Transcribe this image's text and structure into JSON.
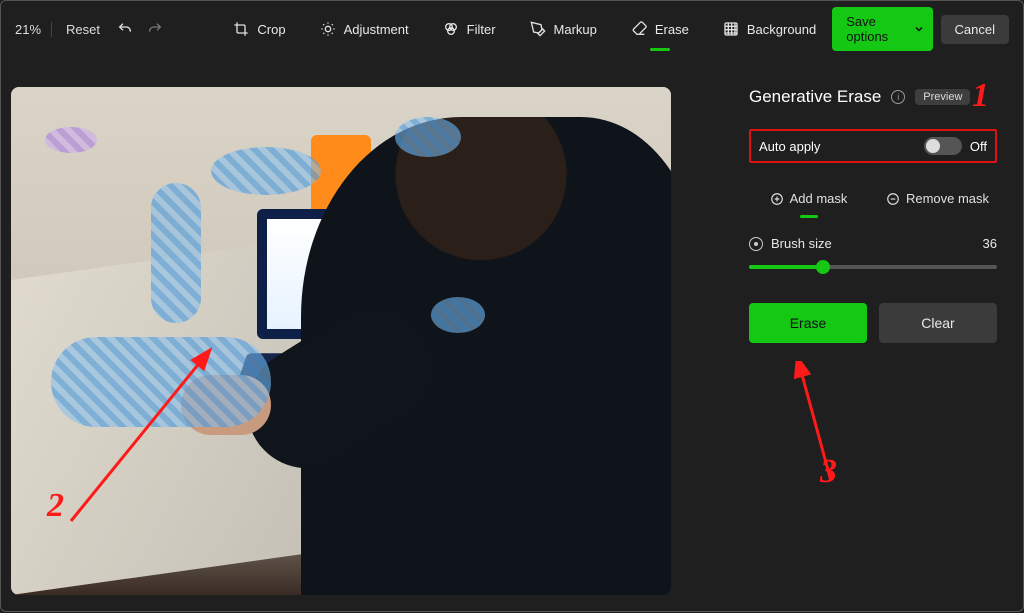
{
  "toolbar": {
    "zoom": "21%",
    "reset": "Reset",
    "tools": {
      "crop": "Crop",
      "adjustment": "Adjustment",
      "filter": "Filter",
      "markup": "Markup",
      "erase": "Erase",
      "background": "Background"
    },
    "save": "Save options",
    "cancel": "Cancel"
  },
  "panel": {
    "title": "Generative Erase",
    "preview_badge": "Preview",
    "auto_apply_label": "Auto apply",
    "auto_apply_state": "Off",
    "add_mask": "Add mask",
    "remove_mask": "Remove mask",
    "brush_label": "Brush size",
    "brush_value": "36",
    "erase_btn": "Erase",
    "clear_btn": "Clear"
  },
  "annotations": {
    "a1": "1",
    "a2": "2",
    "a3": "3"
  }
}
